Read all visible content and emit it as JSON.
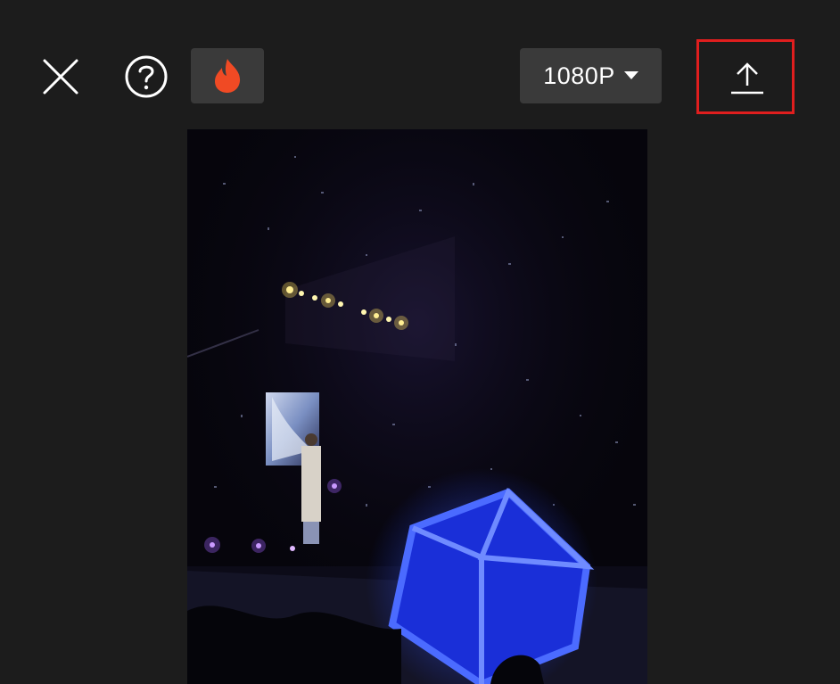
{
  "toolbar": {
    "close_icon": "close-icon",
    "help_icon": "help-circle-icon",
    "hot_icon": "fire-icon",
    "resolution_label": "1080P",
    "resolution_icon": "caret-down-icon",
    "export_icon": "upload-icon"
  },
  "colors": {
    "background": "#1c1c1c",
    "button_bg": "#3a3a3a",
    "fire": "#f04a24",
    "highlight": "#e01e1e",
    "lightstick_blue": "#1e3cff"
  },
  "preview": {
    "content": "concert-video-frame"
  }
}
